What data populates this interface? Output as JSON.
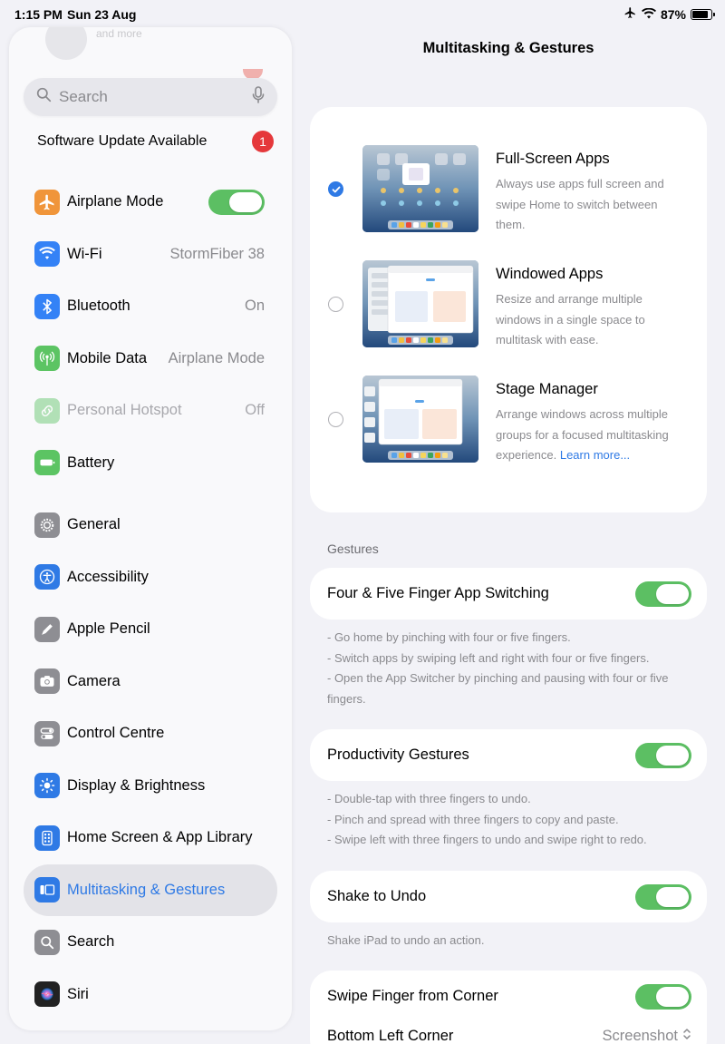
{
  "status": {
    "time": "1:15 PM",
    "date": "Sun 23 Aug",
    "battery": "87%",
    "battery_level": 0.87
  },
  "sidebar": {
    "faded_header": "and more",
    "search_placeholder": "Search",
    "update": {
      "label": "Software Update Available",
      "badge": "1"
    },
    "group1": [
      {
        "label": "Airplane Mode",
        "icon": "airplane-icon",
        "color": "#f0953a",
        "toggle": true
      },
      {
        "label": "Wi-Fi",
        "icon": "wifi-icon",
        "color": "#3482f6",
        "value": "StormFiber 38"
      },
      {
        "label": "Bluetooth",
        "icon": "bluetooth-icon",
        "color": "#3482f6",
        "value": "On"
      },
      {
        "label": "Mobile Data",
        "icon": "antenna-icon",
        "color": "#5cc463",
        "value": "Airplane Mode"
      },
      {
        "label": "Personal Hotspot",
        "icon": "hotspot-icon",
        "color": "#5cc463",
        "value": "Off",
        "disabled": true
      },
      {
        "label": "Battery",
        "icon": "battery-icon",
        "color": "#5cc463"
      }
    ],
    "group2": [
      {
        "label": "General",
        "icon": "gear-icon",
        "color": "#8e8e93"
      },
      {
        "label": "Accessibility",
        "icon": "accessibility-icon",
        "color": "#2f7ae5"
      },
      {
        "label": "Apple Pencil",
        "icon": "pencil-icon",
        "color": "#8e8e93"
      },
      {
        "label": "Camera",
        "icon": "camera-icon",
        "color": "#8e8e93"
      },
      {
        "label": "Control Centre",
        "icon": "switches-icon",
        "color": "#8e8e93"
      },
      {
        "label": "Display & Brightness",
        "icon": "sun-icon",
        "color": "#2f7ae5"
      },
      {
        "label": "Home Screen & App Library",
        "icon": "home-grid-icon",
        "color": "#2f7ae5"
      },
      {
        "label": "Multitasking & Gestures",
        "icon": "multitasking-icon",
        "color": "#2f7ae5",
        "active": true
      },
      {
        "label": "Search",
        "icon": "search-icon",
        "color": "#8e8e93"
      },
      {
        "label": "Siri",
        "icon": "siri-icon",
        "color": "#222222"
      }
    ]
  },
  "main": {
    "title": "Multitasking & Gestures",
    "options": [
      {
        "title": "Full-Screen Apps",
        "desc": "Always use apps full screen and swipe Home to switch between them.",
        "checked": true
      },
      {
        "title": "Windowed Apps",
        "desc": "Resize and arrange multiple windows in a single space to multitask with ease.",
        "checked": false
      },
      {
        "title": "Stage Manager",
        "desc": "Arrange windows across multiple groups for a focused multitasking experience.",
        "link": "Learn more...",
        "checked": false
      }
    ],
    "gestures_header": "Gestures",
    "four_five": {
      "label": "Four & Five Finger App Switching",
      "on": true
    },
    "four_five_notes": [
      "- Go home by pinching with four or five fingers.",
      "- Switch apps by swiping left and right with four or five fingers.",
      "- Open the App Switcher by pinching and pausing with four or five fingers."
    ],
    "productivity": {
      "label": "Productivity Gestures",
      "on": true
    },
    "productivity_notes": [
      "- Double-tap with three fingers to undo.",
      "- Pinch and spread with three fingers to copy and paste.",
      "- Swipe left with three fingers to undo and swipe right to redo."
    ],
    "shake": {
      "label": "Shake to Undo",
      "on": true
    },
    "shake_note": "Shake iPad to undo an action.",
    "swipe_corner": {
      "label": "Swipe Finger from Corner",
      "on": true
    },
    "bottom_left": {
      "label": "Bottom Left Corner",
      "value": "Screenshot"
    },
    "accent": "#2f7ae5",
    "toggle_on_color": "#5cbf63"
  }
}
